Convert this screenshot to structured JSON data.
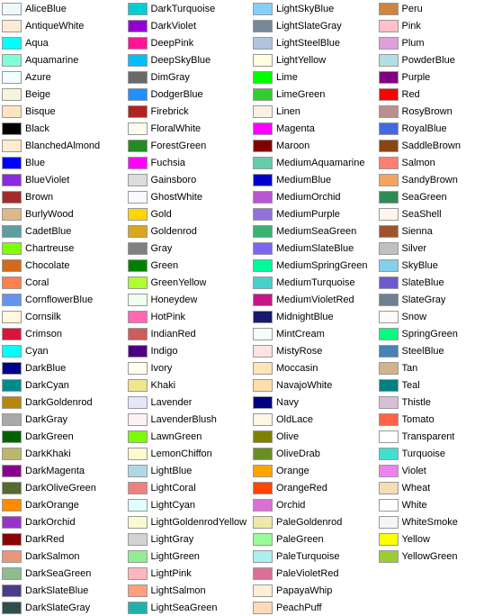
{
  "colors": [
    {
      "name": "AliceBlue",
      "hex": "#F0F8FF"
    },
    {
      "name": "AntiqueWhite",
      "hex": "#FAEBD7"
    },
    {
      "name": "Aqua",
      "hex": "#00FFFF"
    },
    {
      "name": "Aquamarine",
      "hex": "#7FFFD4"
    },
    {
      "name": "Azure",
      "hex": "#F0FFFF"
    },
    {
      "name": "Beige",
      "hex": "#F5F5DC"
    },
    {
      "name": "Bisque",
      "hex": "#FFE4C4"
    },
    {
      "name": "Black",
      "hex": "#000000"
    },
    {
      "name": "BlanchedAlmond",
      "hex": "#FFEBCD"
    },
    {
      "name": "Blue",
      "hex": "#0000FF"
    },
    {
      "name": "BlueViolet",
      "hex": "#8A2BE2"
    },
    {
      "name": "Brown",
      "hex": "#A52A2A"
    },
    {
      "name": "BurlyWood",
      "hex": "#DEB887"
    },
    {
      "name": "CadetBlue",
      "hex": "#5F9EA0"
    },
    {
      "name": "Chartreuse",
      "hex": "#7FFF00"
    },
    {
      "name": "Chocolate",
      "hex": "#D2691E"
    },
    {
      "name": "Coral",
      "hex": "#FF7F50"
    },
    {
      "name": "CornflowerBlue",
      "hex": "#6495ED"
    },
    {
      "name": "Cornsilk",
      "hex": "#FFF8DC"
    },
    {
      "name": "Crimson",
      "hex": "#DC143C"
    },
    {
      "name": "Cyan",
      "hex": "#00FFFF"
    },
    {
      "name": "DarkBlue",
      "hex": "#00008B"
    },
    {
      "name": "DarkCyan",
      "hex": "#008B8B"
    },
    {
      "name": "DarkGoldenrod",
      "hex": "#B8860B"
    },
    {
      "name": "DarkGray",
      "hex": "#A9A9A9"
    },
    {
      "name": "DarkGreen",
      "hex": "#006400"
    },
    {
      "name": "DarkKhaki",
      "hex": "#BDB76B"
    },
    {
      "name": "DarkMagenta",
      "hex": "#8B008B"
    },
    {
      "name": "DarkOliveGreen",
      "hex": "#556B2F"
    },
    {
      "name": "DarkOrange",
      "hex": "#FF8C00"
    },
    {
      "name": "DarkOrchid",
      "hex": "#9932CC"
    },
    {
      "name": "DarkRed",
      "hex": "#8B0000"
    },
    {
      "name": "DarkSalmon",
      "hex": "#E9967A"
    },
    {
      "name": "DarkSeaGreen",
      "hex": "#8FBC8F"
    },
    {
      "name": "DarkSlateBlue",
      "hex": "#483D8B"
    },
    {
      "name": "DarkSlateGray",
      "hex": "#2F4F4F"
    },
    {
      "name": "DarkTurquoise",
      "hex": "#00CED1"
    },
    {
      "name": "DarkViolet",
      "hex": "#9400D3"
    },
    {
      "name": "DeepPink",
      "hex": "#FF1493"
    },
    {
      "name": "DeepSkyBlue",
      "hex": "#00BFFF"
    },
    {
      "name": "DimGray",
      "hex": "#696969"
    },
    {
      "name": "DodgerBlue",
      "hex": "#1E90FF"
    },
    {
      "name": "Firebrick",
      "hex": "#B22222"
    },
    {
      "name": "FloralWhite",
      "hex": "#FFFAF0"
    },
    {
      "name": "ForestGreen",
      "hex": "#228B22"
    },
    {
      "name": "Fuchsia",
      "hex": "#FF00FF"
    },
    {
      "name": "Gainsboro",
      "hex": "#DCDCDC"
    },
    {
      "name": "GhostWhite",
      "hex": "#F8F8FF"
    },
    {
      "name": "Gold",
      "hex": "#FFD700"
    },
    {
      "name": "Goldenrod",
      "hex": "#DAA520"
    },
    {
      "name": "Gray",
      "hex": "#808080"
    },
    {
      "name": "Green",
      "hex": "#008000"
    },
    {
      "name": "GreenYellow",
      "hex": "#ADFF2F"
    },
    {
      "name": "Honeydew",
      "hex": "#F0FFF0"
    },
    {
      "name": "HotPink",
      "hex": "#FF69B4"
    },
    {
      "name": "IndianRed",
      "hex": "#CD5C5C"
    },
    {
      "name": "Indigo",
      "hex": "#4B0082"
    },
    {
      "name": "Ivory",
      "hex": "#FFFFF0"
    },
    {
      "name": "Khaki",
      "hex": "#F0E68C"
    },
    {
      "name": "Lavender",
      "hex": "#E6E6FA"
    },
    {
      "name": "LavenderBlush",
      "hex": "#FFF0F5"
    },
    {
      "name": "LawnGreen",
      "hex": "#7CFC00"
    },
    {
      "name": "LemonChiffon",
      "hex": "#FFFACD"
    },
    {
      "name": "LightBlue",
      "hex": "#ADD8E6"
    },
    {
      "name": "LightCoral",
      "hex": "#F08080"
    },
    {
      "name": "LightCyan",
      "hex": "#E0FFFF"
    },
    {
      "name": "LightGoldenrodYellow",
      "hex": "#FAFAD2"
    },
    {
      "name": "LightGray",
      "hex": "#D3D3D3"
    },
    {
      "name": "LightGreen",
      "hex": "#90EE90"
    },
    {
      "name": "LightPink",
      "hex": "#FFB6C1"
    },
    {
      "name": "LightSalmon",
      "hex": "#FFA07A"
    },
    {
      "name": "LightSeaGreen",
      "hex": "#20B2AA"
    },
    {
      "name": "LightSkyBlue",
      "hex": "#87CEFA"
    },
    {
      "name": "LightSlateGray",
      "hex": "#778899"
    },
    {
      "name": "LightSteelBlue",
      "hex": "#B0C4DE"
    },
    {
      "name": "LightYellow",
      "hex": "#FFFFE0"
    },
    {
      "name": "Lime",
      "hex": "#00FF00"
    },
    {
      "name": "LimeGreen",
      "hex": "#32CD32"
    },
    {
      "name": "Linen",
      "hex": "#FAF0E6"
    },
    {
      "name": "Magenta",
      "hex": "#FF00FF"
    },
    {
      "name": "Maroon",
      "hex": "#800000"
    },
    {
      "name": "MediumAquamarine",
      "hex": "#66CDAA"
    },
    {
      "name": "MediumBlue",
      "hex": "#0000CD"
    },
    {
      "name": "MediumOrchid",
      "hex": "#BA55D3"
    },
    {
      "name": "MediumPurple",
      "hex": "#9370DB"
    },
    {
      "name": "MediumSeaGreen",
      "hex": "#3CB371"
    },
    {
      "name": "MediumSlateBlue",
      "hex": "#7B68EE"
    },
    {
      "name": "MediumSpringGreen",
      "hex": "#00FA9A"
    },
    {
      "name": "MediumTurquoise",
      "hex": "#48D1CC"
    },
    {
      "name": "MediumVioletRed",
      "hex": "#C71585"
    },
    {
      "name": "MidnightBlue",
      "hex": "#191970"
    },
    {
      "name": "MintCream",
      "hex": "#F5FFFA"
    },
    {
      "name": "MistyRose",
      "hex": "#FFE4E1"
    },
    {
      "name": "Moccasin",
      "hex": "#FFE4B5"
    },
    {
      "name": "NavajoWhite",
      "hex": "#FFDEAD"
    },
    {
      "name": "Navy",
      "hex": "#000080"
    },
    {
      "name": "OldLace",
      "hex": "#FDF5E6"
    },
    {
      "name": "Olive",
      "hex": "#808000"
    },
    {
      "name": "OliveDrab",
      "hex": "#6B8E23"
    },
    {
      "name": "Orange",
      "hex": "#FFA500"
    },
    {
      "name": "OrangeRed",
      "hex": "#FF4500"
    },
    {
      "name": "Orchid",
      "hex": "#DA70D6"
    },
    {
      "name": "PaleGoldenrod",
      "hex": "#EEE8AA"
    },
    {
      "name": "PaleGreen",
      "hex": "#98FB98"
    },
    {
      "name": "PaleTurquoise",
      "hex": "#AFEEEE"
    },
    {
      "name": "PaleVioletRed",
      "hex": "#DB7093"
    },
    {
      "name": "PapayaWhip",
      "hex": "#FFEFD5"
    },
    {
      "name": "PeachPuff",
      "hex": "#FFDAB9"
    },
    {
      "name": "Peru",
      "hex": "#CD853F"
    },
    {
      "name": "Pink",
      "hex": "#FFC0CB"
    },
    {
      "name": "Plum",
      "hex": "#DDA0DD"
    },
    {
      "name": "PowderBlue",
      "hex": "#B0E0E6"
    },
    {
      "name": "Purple",
      "hex": "#800080"
    },
    {
      "name": "Red",
      "hex": "#FF0000"
    },
    {
      "name": "RosyBrown",
      "hex": "#BC8F8F"
    },
    {
      "name": "RoyalBlue",
      "hex": "#4169E1"
    },
    {
      "name": "SaddleBrown",
      "hex": "#8B4513"
    },
    {
      "name": "Salmon",
      "hex": "#FA8072"
    },
    {
      "name": "SandyBrown",
      "hex": "#F4A460"
    },
    {
      "name": "SeaGreen",
      "hex": "#2E8B57"
    },
    {
      "name": "SeaShell",
      "hex": "#FFF5EE"
    },
    {
      "name": "Sienna",
      "hex": "#A0522D"
    },
    {
      "name": "Silver",
      "hex": "#C0C0C0"
    },
    {
      "name": "SkyBlue",
      "hex": "#87CEEB"
    },
    {
      "name": "SlateBlue",
      "hex": "#6A5ACD"
    },
    {
      "name": "SlateGray",
      "hex": "#708090"
    },
    {
      "name": "Snow",
      "hex": "#FFFAFA"
    },
    {
      "name": "SpringGreen",
      "hex": "#00FF7F"
    },
    {
      "name": "SteelBlue",
      "hex": "#4682B4"
    },
    {
      "name": "Tan",
      "hex": "#D2B48C"
    },
    {
      "name": "Teal",
      "hex": "#008080"
    },
    {
      "name": "Thistle",
      "hex": "#D8BFD8"
    },
    {
      "name": "Tomato",
      "hex": "#FF6347"
    },
    {
      "name": "Transparent",
      "hex": "transparent"
    },
    {
      "name": "Turquoise",
      "hex": "#40E0D0"
    },
    {
      "name": "Violet",
      "hex": "#EE82EE"
    },
    {
      "name": "Wheat",
      "hex": "#F5DEB3"
    },
    {
      "name": "White",
      "hex": "#FFFFFF"
    },
    {
      "name": "WhiteSmoke",
      "hex": "#F5F5F5"
    },
    {
      "name": "Yellow",
      "hex": "#FFFF00"
    },
    {
      "name": "YellowGreen",
      "hex": "#9ACD32"
    }
  ]
}
